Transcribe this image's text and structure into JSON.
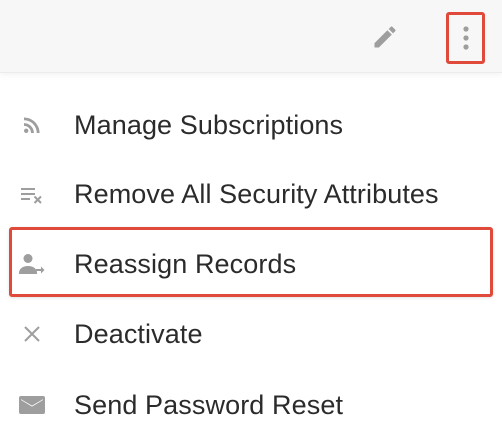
{
  "toolbar": {
    "edit_icon": "pencil-icon",
    "more_icon": "kebab-menu-icon"
  },
  "menu": {
    "items": [
      {
        "label": "Manage Subscriptions",
        "icon": "rss-feed-icon"
      },
      {
        "label": "Remove All Security Attributes",
        "icon": "clear-list-icon"
      },
      {
        "label": "Reassign Records",
        "icon": "person-reassign-icon"
      },
      {
        "label": "Deactivate",
        "icon": "close-icon"
      },
      {
        "label": "Send Password Reset",
        "icon": "mail-icon"
      }
    ]
  },
  "colors": {
    "highlight": "#e04a3a",
    "icon": "#9e9e9e",
    "text": "#2b2b2b",
    "topbar": "#f7f7f7"
  }
}
